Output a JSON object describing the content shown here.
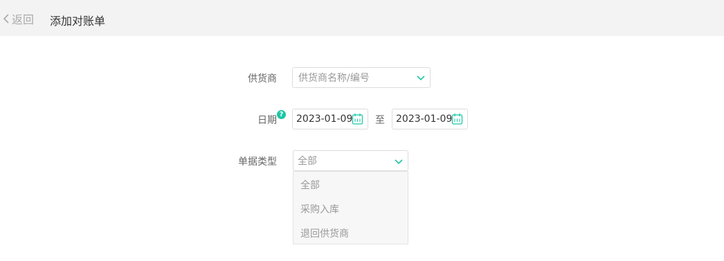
{
  "header": {
    "back_label": "返回",
    "title": "添加对账单"
  },
  "form": {
    "supplier": {
      "label": "供货商",
      "placeholder": "供货商名称/编号"
    },
    "date": {
      "label": "日期",
      "help": "?",
      "start": "2023-01-09",
      "separator": "至",
      "end": "2023-01-09"
    },
    "doc_type": {
      "label": "单据类型",
      "selected": "全部",
      "options": [
        "全部",
        "采购入库",
        "退回供货商"
      ]
    }
  },
  "colors": {
    "accent": "#1ec6a6",
    "header_bg": "#f3f3f3"
  }
}
